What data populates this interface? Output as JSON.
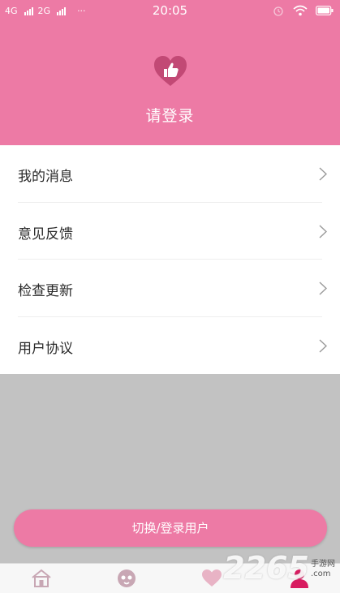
{
  "status_bar": {
    "network1": "4G",
    "network2": "2G",
    "more": "···",
    "time": "20:05"
  },
  "header": {
    "login_prompt": "请登录",
    "logo_icon": "heart-thumbs-up-icon"
  },
  "menu": {
    "items": [
      {
        "label": "我的消息"
      },
      {
        "label": "意见反馈"
      },
      {
        "label": "检查更新"
      },
      {
        "label": "用户协议"
      }
    ]
  },
  "switch_button": {
    "label": "切换/登录用户"
  },
  "tabbar": {
    "tabs": [
      {
        "icon": "home-icon"
      },
      {
        "icon": "face-icon"
      },
      {
        "icon": "heart-icon"
      },
      {
        "icon": "user-icon",
        "active": true
      }
    ]
  },
  "watermark": {
    "number": "2265",
    "line1": "手游网",
    "line2": ".com"
  },
  "colors": {
    "brand_pink": "#ed7aa5",
    "background_gray": "#c2c2c2",
    "active_tab": "#d81b60"
  }
}
